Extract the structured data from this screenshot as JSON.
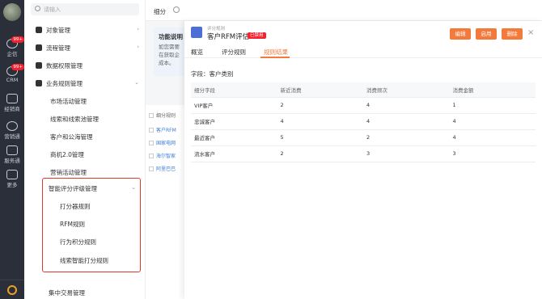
{
  "rail": {
    "items": [
      {
        "label": "企信",
        "badge": "99+"
      },
      {
        "label": "CRM",
        "badge": "99+"
      },
      {
        "label": "经销商"
      },
      {
        "label": "营销通"
      },
      {
        "label": "服务通"
      },
      {
        "label": "更多"
      }
    ]
  },
  "nav": {
    "search_placeholder": "请输入",
    "items": [
      {
        "label": "对象管理",
        "chevron": "›"
      },
      {
        "label": "流程管理",
        "chevron": "›"
      },
      {
        "label": "数据权限管理"
      },
      {
        "label": "业务规则管理",
        "chevron": "⌄"
      }
    ],
    "sub_items": [
      {
        "label": "市场活动管理"
      },
      {
        "label": "线索和线索池管理"
      },
      {
        "label": "客户和公海管理"
      },
      {
        "label": "商机2.0管理"
      },
      {
        "label": "营销活动管理"
      },
      {
        "label": "智能评分评级管理",
        "chevron": "⌄"
      }
    ],
    "deep_items": [
      {
        "label": "打分器规则"
      },
      {
        "label": "RFM规则"
      },
      {
        "label": "行为积分规则"
      },
      {
        "label": "线索智能打分规则"
      }
    ],
    "bottom_item": "集中交易管理"
  },
  "main": {
    "title": "细分",
    "info_title": "功能说明",
    "info_lines": [
      "如您需要",
      "在获取企",
      "成本。"
    ],
    "list_header": "细分规则",
    "list_rows": [
      "客户RFM",
      "国家电网",
      "海尔智家",
      "阿里巴巴"
    ]
  },
  "drawer": {
    "supertitle": "评分规则",
    "title": "客户RFM评估",
    "status_tag": "已禁用",
    "buttons": {
      "edit": "编辑",
      "enable": "启用",
      "delete": "删除"
    },
    "close": "×",
    "tabs": [
      "概览",
      "评分规则",
      "规则结果"
    ],
    "field_label": "字段：客户类别",
    "table": {
      "headers": [
        "细分字段",
        "新近消费",
        "消费频次",
        "消费金额"
      ],
      "rows": [
        [
          "VIP客户",
          "2",
          "4",
          "1"
        ],
        [
          "忠诚客户",
          "4",
          "4",
          "4"
        ],
        [
          "最近客户",
          "5",
          "2",
          "4"
        ],
        [
          "流水客户",
          "2",
          "3",
          "3"
        ]
      ]
    }
  },
  "colors": {
    "accent": "#f47a3c",
    "danger": "#e0362c",
    "rail_bg": "#2b2f3a",
    "link": "#3a7bd5"
  }
}
